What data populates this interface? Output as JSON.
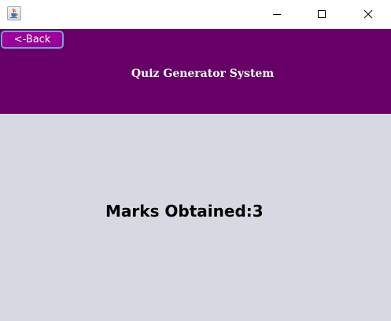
{
  "window": {
    "app_icon": "java-cup-icon",
    "controls": {
      "minimize_icon": "minimize-icon",
      "maximize_icon": "maximize-icon",
      "close_icon": "close-icon"
    }
  },
  "header": {
    "back_label": "<-Back",
    "title": "Quiz Generator System",
    "background_color": "#660066",
    "back_button_color": "#990099"
  },
  "result": {
    "label": "Marks Obtained:",
    "value": "3"
  },
  "content": {
    "background_color": "#d6d9e1"
  }
}
